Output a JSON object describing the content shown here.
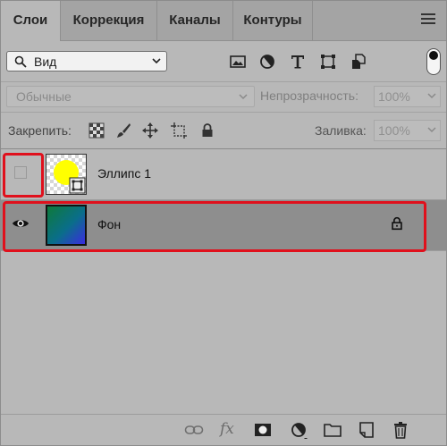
{
  "tabs": [
    {
      "label": "Слои",
      "active": true
    },
    {
      "label": "Коррекция",
      "active": false
    },
    {
      "label": "Каналы",
      "active": false
    },
    {
      "label": "Контуры",
      "active": false
    }
  ],
  "filter": {
    "kind_label": "Вид",
    "icons": [
      "image-filter-icon",
      "adjustment-filter-icon",
      "type-filter-icon",
      "shape-filter-icon",
      "smart-object-filter-icon"
    ],
    "toggle_on": true
  },
  "blend": {
    "mode": "Обычные",
    "opacity_label": "Непрозрачность:",
    "opacity_value": "100%"
  },
  "lock": {
    "label": "Закрепить:",
    "icons": [
      "lock-transparent-icon",
      "lock-paint-icon",
      "lock-position-icon",
      "lock-artboard-icon",
      "lock-all-icon"
    ],
    "fill_label": "Заливка:",
    "fill_value": "100%"
  },
  "layers": [
    {
      "name": "Эллипс 1",
      "visible": false,
      "selected": false,
      "locked": false,
      "thumb": "ellipse-yellow",
      "highlight": "visibility-box"
    },
    {
      "name": "Фон",
      "visible": true,
      "selected": true,
      "locked": true,
      "thumb": "gradient-green-blue",
      "highlight": "full-row"
    }
  ],
  "bottom_bar": {
    "icons": [
      "link-layers-icon",
      "fx-icon",
      "add-mask-icon",
      "adjustment-layer-icon",
      "new-group-icon",
      "new-layer-icon",
      "delete-layer-icon"
    ],
    "fx_label": "fx"
  },
  "colors": {
    "panel_bg": "#b8b8b8",
    "selected_row": "#8e8e8e",
    "highlight": "#e0101c",
    "ellipse": "#ffff00"
  }
}
